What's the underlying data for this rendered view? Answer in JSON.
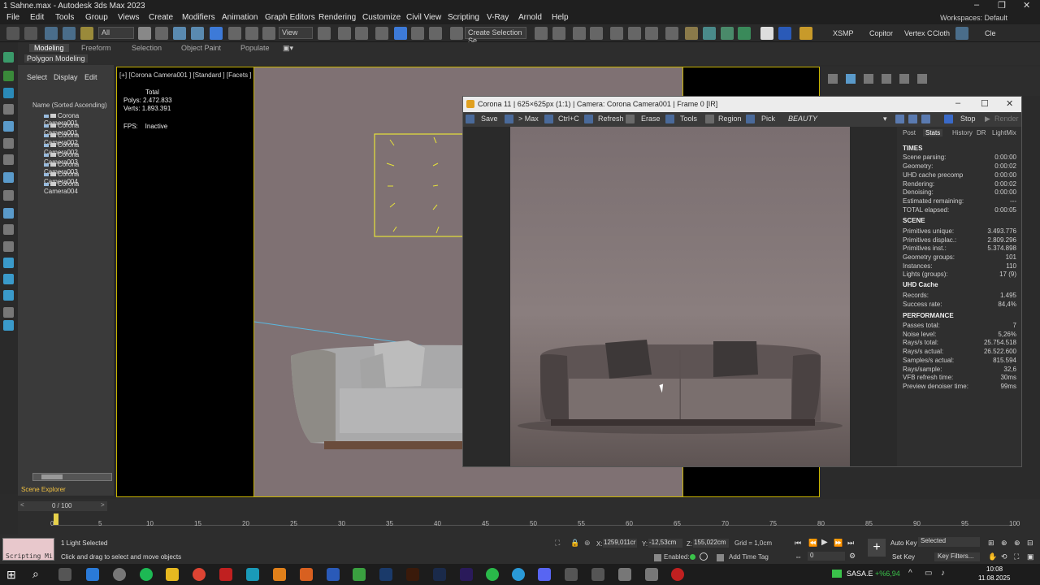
{
  "window": {
    "title": "1 Sahne.max - Autodesk 3ds Max 2023"
  },
  "menu": [
    "File",
    "Edit",
    "Tools",
    "Group",
    "Views",
    "Create",
    "Modifiers",
    "Animation",
    "Graph Editors",
    "Rendering",
    "Customize",
    "Civil View",
    "Scripting",
    "V-Ray",
    "Arnold",
    "Help"
  ],
  "workspaces": "Workspaces: Default",
  "toolbar": {
    "filter": "All",
    "view": "View",
    "selection_set": "Create Selection Se",
    "right_labels": [
      "XSMP",
      "Copitor",
      "Vertex C",
      "Cloth",
      "Cle"
    ]
  },
  "ribbon": {
    "tabs": [
      "Modeling",
      "Freeform",
      "Selection",
      "Object Paint",
      "Populate"
    ],
    "sub": "Polygon Modeling"
  },
  "explorer": {
    "tabs": [
      "Select",
      "Display",
      "Edit"
    ],
    "column": "Name (Sorted Ascending)",
    "items": [
      "Corona Camera001",
      "Corona Camera001",
      "Corona Camera002",
      "Corona Camera002",
      "Corona Camera003",
      "Corona Camera003",
      "Corona Camera004",
      "Corona Camera004"
    ],
    "footer": "Scene Explorer"
  },
  "viewport": {
    "label": "[+] [Corona Camera001 ] [Standard ] [Facets ]",
    "stats": {
      "total_label": "Total",
      "polys_label": "Polys:",
      "polys": "2.472.833",
      "verts_label": "Verts:",
      "verts": "1.893.391",
      "fps_label": "FPS:",
      "fps": "Inactive"
    }
  },
  "corona": {
    "title": "Corona 11 | 625×625px (1:1) | Camera: Corona Camera001 | Frame 0 [IR]",
    "toolbar": [
      "Save",
      "> Max",
      "Ctrl+C",
      "Refresh",
      "Erase",
      "Tools",
      "Region",
      "Pick"
    ],
    "channel": "BEAUTY",
    "stop": "Stop",
    "render": "Render",
    "tabs": [
      "Post",
      "Stats",
      "History",
      "DR",
      "LightMix"
    ],
    "times_header": "TIMES",
    "times": [
      {
        "k": "Scene parsing:",
        "v": "0:00:00"
      },
      {
        "k": "Geometry:",
        "v": "0:00:02"
      },
      {
        "k": "UHD cache precomp",
        "v": "0:00:00"
      },
      {
        "k": "Rendering:",
        "v": "0:00:02"
      },
      {
        "k": "Denoising:",
        "v": "0:00:00"
      },
      {
        "k": "Estimated remaining:",
        "v": "---"
      },
      {
        "k": "TOTAL elapsed:",
        "v": "0:00:05"
      }
    ],
    "scene_header": "SCENE",
    "scene": [
      {
        "k": "Primitives unique:",
        "v": "3.493.776"
      },
      {
        "k": "Primitives displac.:",
        "v": "2.809.296"
      },
      {
        "k": "Primitives inst.:",
        "v": "5.374.898"
      },
      {
        "k": "Geometry groups:",
        "v": "101"
      },
      {
        "k": "Instances:",
        "v": "110"
      },
      {
        "k": "Lights (groups):",
        "v": "17 (9)"
      }
    ],
    "uhd_header": "UHD Cache",
    "uhd": [
      {
        "k": "Records:",
        "v": "1.495"
      },
      {
        "k": "Success rate:",
        "v": "84,4%"
      }
    ],
    "perf_header": "PERFORMANCE",
    "perf": [
      {
        "k": "Passes total:",
        "v": "7"
      },
      {
        "k": "Noise level:",
        "v": "5,26%"
      },
      {
        "k": "Rays/s total:",
        "v": "25.754.518"
      },
      {
        "k": "Rays/s actual:",
        "v": "26.522.600"
      },
      {
        "k": "Samples/s actual:",
        "v": "815.594"
      },
      {
        "k": "Rays/sample:",
        "v": "32,6"
      },
      {
        "k": "VFB refresh time:",
        "v": "30ms"
      },
      {
        "k": "Preview denoiser time:",
        "v": "99ms"
      }
    ]
  },
  "timeline": {
    "frame": "0 / 100",
    "ticks": [
      "0",
      "5",
      "10",
      "15",
      "20",
      "25",
      "30",
      "35",
      "40",
      "45",
      "50",
      "55",
      "60",
      "65",
      "70",
      "75",
      "80",
      "85",
      "90",
      "95",
      "100"
    ]
  },
  "status": {
    "script": "Scripting Mi",
    "selected": "1 Light Selected",
    "prompt": "Click and drag to select and move objects",
    "x_label": "X:",
    "x": "1259,011cr",
    "y_label": "Y:",
    "y": "-12,53cm",
    "z_label": "Z:",
    "z": "155,022cm",
    "grid": "Grid = 1,0cm",
    "enabled": "Enabled:",
    "add_time_tag": "Add Time Tag",
    "autokey": "Auto Key",
    "setkey": "Set Key",
    "selected_dd": "Selected",
    "key_filters": "Key Filters...",
    "frame": "0"
  },
  "taskbar": {
    "tray": "SASA.E",
    "tray2": "+%6,94",
    "time": "10:08",
    "date": "11.08.2025"
  }
}
